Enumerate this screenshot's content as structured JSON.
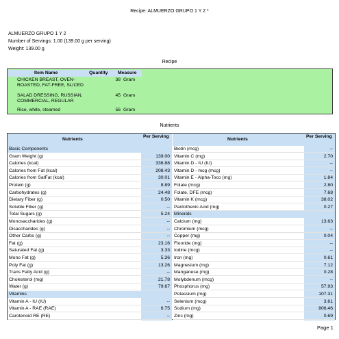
{
  "page": {
    "title": "Recipe: ALMUERZO GRUPO 1 Y 2 *",
    "footer": "Page 1"
  },
  "summary": {
    "name": "ALMUERZO GRUPO 1 Y 2",
    "servings": "Number of Servings: 1.00  (139.00 g per serving)",
    "weight": "Weight: 139.00 g"
  },
  "recipe": {
    "section_title": "Recipe",
    "headers": {
      "item": "Item Name",
      "quantity": "Quantity",
      "measure": "Measure"
    },
    "items": [
      {
        "name": "CHICKEN BREAST, OVEN-ROASTED, FAT-FREE, SLICED",
        "quantity": "38",
        "measure": "Gram"
      },
      {
        "name": "SALAD DRESSING, RUSSIAN, COMMERCIAL, REGULAR",
        "quantity": "45",
        "measure": "Gram"
      },
      {
        "name": "Rice, white, steamed",
        "quantity": "56",
        "measure": "Gram"
      }
    ]
  },
  "nutrients": {
    "section_title": "Nutrients",
    "headers": {
      "nutrients": "Nutrients",
      "per_serving": "Per Serving"
    },
    "left": [
      {
        "section": "Basic Components"
      },
      {
        "label": "Gram Weight (g)",
        "value": "139.00"
      },
      {
        "label": "Calories (kcal)",
        "value": "336.88"
      },
      {
        "label": "Calories from Fat (kcal)",
        "value": "208.43"
      },
      {
        "label": "Calories from SatFat (kcal)",
        "value": "30.01"
      },
      {
        "label": "Protein (g)",
        "value": "8.89"
      },
      {
        "label": "Carbohydrates (g)",
        "value": "24.48"
      },
      {
        "label": "Dietary Fiber (g)",
        "value": "0.50"
      },
      {
        "label": "Soluble Fiber (g)",
        "value": "--"
      },
      {
        "label": "Total Sugars (g)",
        "value": "5.24"
      },
      {
        "label": "Monosaccharides (g)",
        "value": "--"
      },
      {
        "label": "Disaccharides (g)",
        "value": "--"
      },
      {
        "label": "Other Carbs (g)",
        "value": "--"
      },
      {
        "label": "Fat (g)",
        "value": "23.16"
      },
      {
        "label": "Saturated Fat (g)",
        "value": "3.33"
      },
      {
        "label": "Mono Fat (g)",
        "value": "5.36"
      },
      {
        "label": "Poly Fat (g)",
        "value": "13.26"
      },
      {
        "label": "Trans Fatty Acid (g)",
        "value": "--"
      },
      {
        "label": "Cholesterol (mg)",
        "value": "21.78"
      },
      {
        "label": "Water (g)",
        "value": "79.67"
      },
      {
        "section": "Vitamins"
      },
      {
        "label": "Vitamin A - IU (IU)",
        "value": "--"
      },
      {
        "label": "Vitamin A - RAE (RAE)",
        "value": "6.75"
      },
      {
        "label": "Carotenoid RE (RE)",
        "value": "--"
      }
    ],
    "right": [
      {
        "label": "Biotin (mcg)",
        "value": "--"
      },
      {
        "label": "Vitamin C (mg)",
        "value": "2.70"
      },
      {
        "label": "Vitamin D - IU (IU)",
        "value": "--"
      },
      {
        "label": "Vitamin D - mcg (mcg)",
        "value": "--"
      },
      {
        "label": "Vitamin E - Alpha-Toco (mg)",
        "value": "1.84"
      },
      {
        "label": "Folate (mcg)",
        "value": "2.80"
      },
      {
        "label": "Folate, DFE (mcg)",
        "value": "7.68"
      },
      {
        "label": "Vitamin K (mcg)",
        "value": "38.02"
      },
      {
        "label": "Pantothenic Acid (mg)",
        "value": "0.27"
      },
      {
        "section": "Minerals"
      },
      {
        "label": "Calcium (mg)",
        "value": "13.63"
      },
      {
        "label": "Chromium (mcg)",
        "value": "--"
      },
      {
        "label": "Copper (mg)",
        "value": "0.04"
      },
      {
        "label": "Fluoride (mg)",
        "value": "--"
      },
      {
        "label": "Iodine (mcg)",
        "value": "--"
      },
      {
        "label": "Iron (mg)",
        "value": "0.61"
      },
      {
        "label": "Magnesium (mg)",
        "value": "7.12"
      },
      {
        "label": "Manganese (mg)",
        "value": "0.28"
      },
      {
        "label": "Molybdenum (mcg)",
        "value": "--"
      },
      {
        "label": "Phosphorus (mg)",
        "value": "57.93"
      },
      {
        "label": "Potassium (mg)",
        "value": "107.31"
      },
      {
        "label": "Selenium (mcg)",
        "value": "3.61"
      },
      {
        "label": "Sodium (mg)",
        "value": "806.46"
      },
      {
        "label": "Zinc (mg)",
        "value": "0.69"
      }
    ]
  }
}
